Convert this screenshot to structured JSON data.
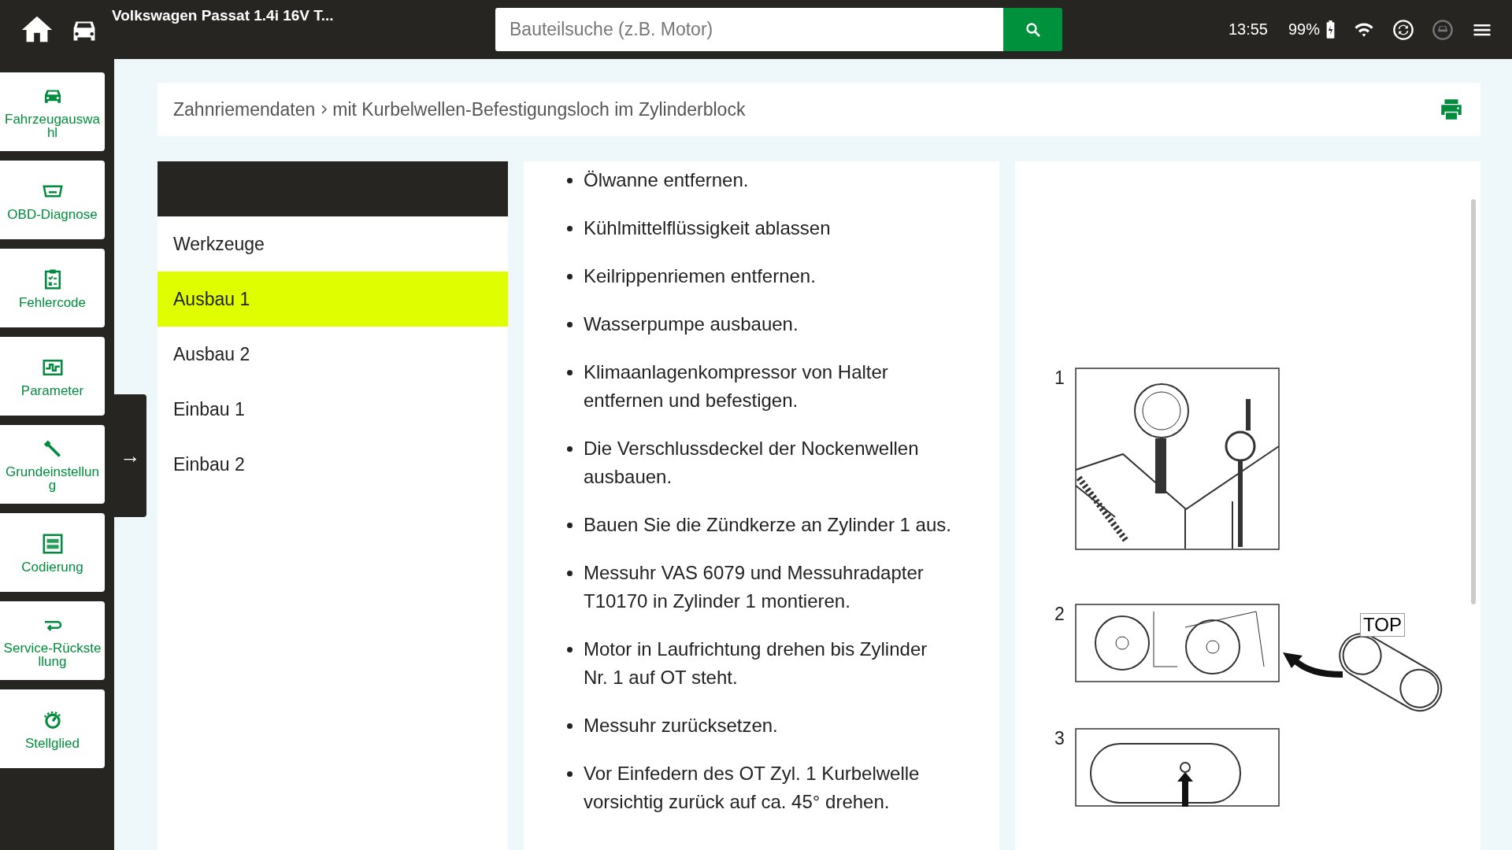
{
  "top_bar": {
    "vehicle_title": "Volkswagen Passat 1.4i 16V T...",
    "search": {
      "placeholder": "Bauteilsuche (z.B. Motor)"
    },
    "time": "13:55",
    "battery": "99%"
  },
  "sidebar": {
    "items": [
      {
        "label": "Fahrzeugauswahl",
        "kind": "car"
      },
      {
        "label": "OBD-Diagnose",
        "kind": "obd"
      },
      {
        "label": "Fehlercode",
        "kind": "clipboard"
      },
      {
        "label": "Parameter",
        "kind": "wave"
      },
      {
        "label": "Grundeinstellung",
        "kind": "wrench"
      },
      {
        "label": "Codierung",
        "kind": "binary"
      },
      {
        "label": "Service-Rückstellung",
        "kind": "return"
      },
      {
        "label": "Stellglied",
        "kind": "dial"
      }
    ],
    "toggle": "→"
  },
  "breadcrumb": {
    "parts": [
      "Zahnriemendaten",
      "mit Kurbelwellen-Befestigungsloch im Zylinderblock"
    ]
  },
  "menu": {
    "items": [
      {
        "label": "Werkzeuge",
        "selected": false
      },
      {
        "label": "Ausbau 1",
        "selected": true
      },
      {
        "label": "Ausbau 2",
        "selected": false
      },
      {
        "label": "Einbau 1",
        "selected": false
      },
      {
        "label": "Einbau 2",
        "selected": false
      }
    ]
  },
  "steps": [
    "Ölwanne entfernen.",
    "Kühlmittelflüssigkeit ablassen",
    "Keilrippenriemen entfernen.",
    "Wasserpumpe ausbauen.",
    "Klimaanlagenkompressor von Halter entfernen und befestigen.",
    "Die Verschlussdeckel der Nockenwellen ausbauen.",
    "Bauen Sie die Zündkerze an Zylinder 1 aus.",
    "Messuhr VAS 6079 und Messuhradapter T10170 in Zylinder 1 montieren.",
    "Motor in Laufrichtung drehen bis Zylinder Nr. 1 auf OT steht.",
    "Messuhr zurücksetzen.",
    "Vor Einfedern des OT Zyl. 1 Kurbelwelle vorsichtig zurück auf ca. 45° drehen."
  ],
  "figure": {
    "labels": [
      "1",
      "2",
      "3"
    ],
    "callout": "TOP"
  }
}
